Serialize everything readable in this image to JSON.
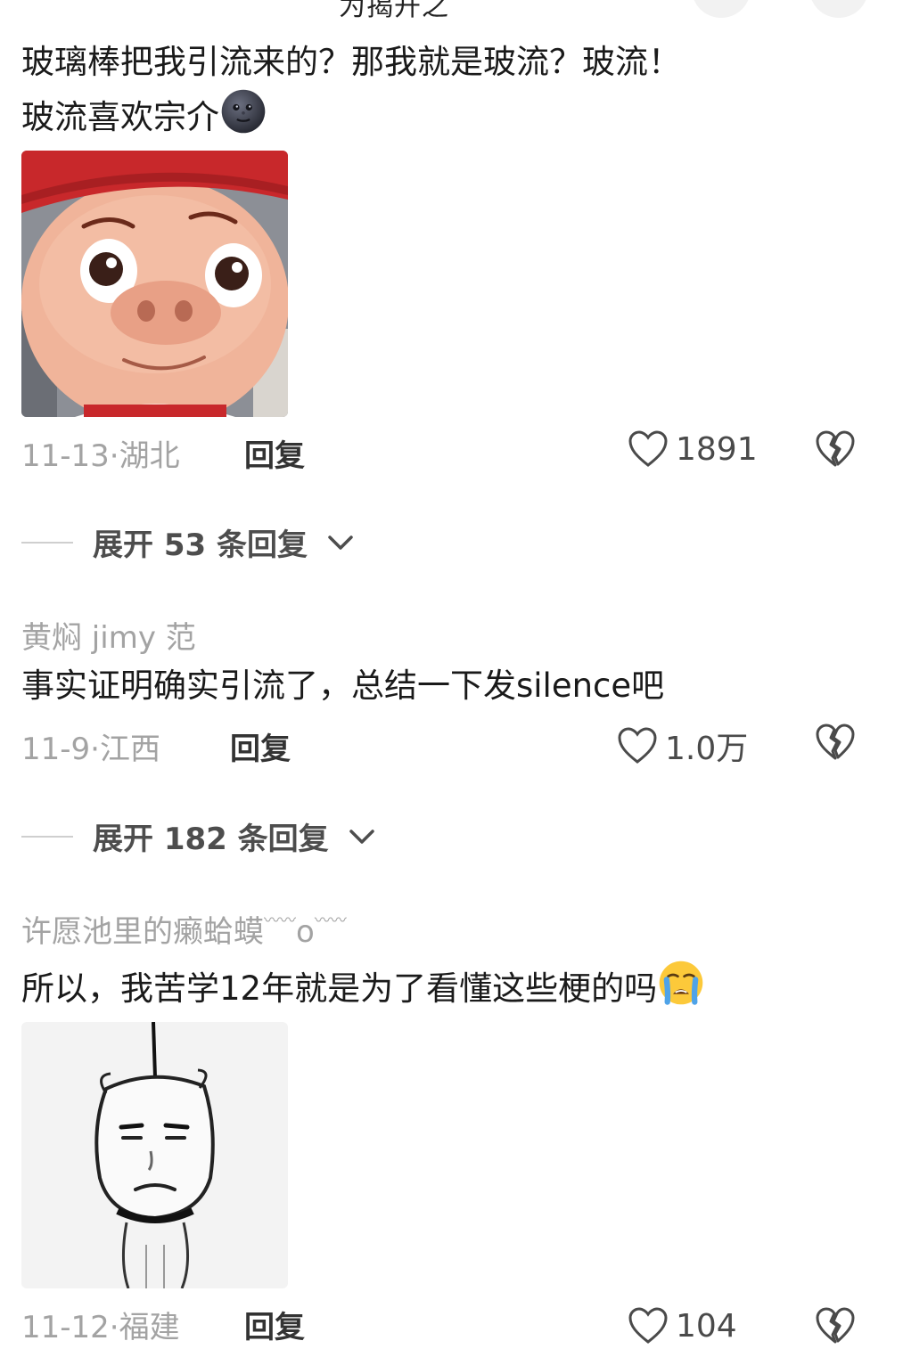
{
  "header": {
    "title_partial": "为揭开之"
  },
  "comments": [
    {
      "text_line1": "玻璃棒把我引流来的？那我就是玻流？玻流！",
      "text_line2": "玻流喜欢宗介",
      "emoji": "new-moon-face-emoji",
      "image": "cartoon-pig-face-sticker",
      "date": "11-13",
      "separator": "·",
      "location": "湖北",
      "reply_label": "回复",
      "likes": "1891",
      "expand_label": "展开 53 条回复"
    },
    {
      "username": "黄焖 jimy 范",
      "text": "事实证明确实引流了，总结一下发silence吧",
      "date": "11-9",
      "separator": "·",
      "location": "江西",
      "reply_label": "回复",
      "likes": "1.0万",
      "expand_label": "展开 182 条回复"
    },
    {
      "username_main": "许愿池里的癞蛤蟆",
      "username_deco1": "〰〰",
      "username_o": "o",
      "username_deco2": "〰〰",
      "text": "所以，我苦学12年就是为了看懂这些梗的吗",
      "emoji": "loudly-crying-face-emoji",
      "image": "hanging-meme-sketch-sticker",
      "date": "11-12",
      "separator": "·",
      "location": "福建",
      "reply_label": "回复",
      "likes_partial": "104"
    }
  ],
  "colors": {
    "meta_gray": "#a3a3a3",
    "text_dark": "#1a1a1a",
    "pig_hat": "#c8282b",
    "pig_skin": "#f0b49a",
    "emoji_yellow": "#fcc93a",
    "emoji_tear": "#4fa3e8"
  }
}
